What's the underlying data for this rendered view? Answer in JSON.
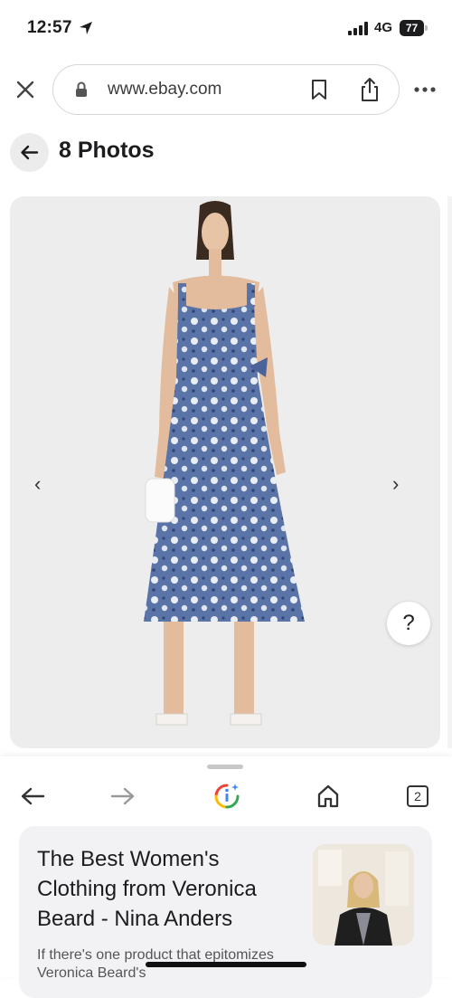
{
  "status_bar": {
    "time": "12:57",
    "network": "4G",
    "battery": "77",
    "icons": [
      "location-arrow-icon",
      "signal-bars-icon",
      "battery-icon"
    ]
  },
  "browser": {
    "url": "www.ebay.com",
    "icons": [
      "close-icon",
      "lock-icon",
      "bookmark-icon",
      "share-icon",
      "more-icon"
    ]
  },
  "header": {
    "title": "8 Photos",
    "back_icon": "arrow-left-icon"
  },
  "viewer": {
    "prev_glyph": "‹",
    "next_glyph": "›",
    "help_label": "?"
  },
  "toolbar": {
    "tab_count": "2",
    "icons": [
      "arrow-left-icon",
      "arrow-right-icon",
      "google-lens-icon",
      "home-icon",
      "tabs-icon"
    ]
  },
  "article": {
    "title": "The Best Women's Clothing from Veronica Beard - Nina Anders",
    "snippet": "If there's one product that epitomizes Veronica Beard's"
  },
  "colors": {
    "photo_background": "#ededed",
    "dress_blue": "#5a74a8",
    "card_background": "#f2f2f5",
    "lens_blue": "#4285f4",
    "lens_red": "#ea4335",
    "lens_yellow": "#fbbc05",
    "lens_green": "#34a853"
  }
}
